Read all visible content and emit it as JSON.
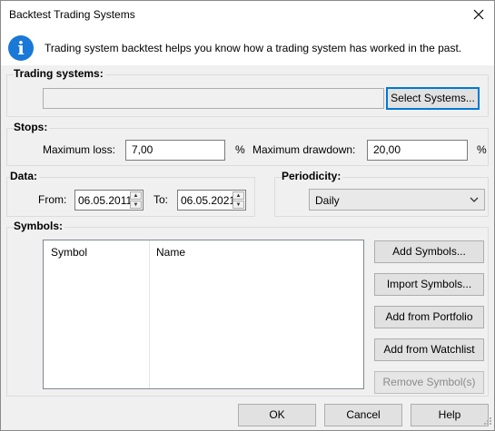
{
  "window": {
    "title": "Backtest Trading Systems",
    "close_icon": "close-icon"
  },
  "info": {
    "icon": "info-icon",
    "icon_glyph": "i",
    "text": "Trading system backtest helps you know how a trading system has worked in the past."
  },
  "trading_systems": {
    "label": "Trading systems:",
    "field_value": "",
    "select_button": "Select Systems..."
  },
  "stops": {
    "label": "Stops:",
    "max_loss_label": "Maximum loss:",
    "max_loss_value": "7,00",
    "max_loss_unit": "%",
    "max_drawdown_label": "Maximum drawdown:",
    "max_drawdown_value": "20,00",
    "max_drawdown_unit": "%"
  },
  "data": {
    "label": "Data:",
    "from_label": "From:",
    "from_value": "06.05.2011",
    "to_label": "To:",
    "to_value": "06.05.2021"
  },
  "periodicity": {
    "label": "Periodicity:",
    "selected": "Daily"
  },
  "symbols": {
    "label": "Symbols:",
    "columns": [
      "Symbol",
      "Name"
    ],
    "rows": [],
    "buttons": {
      "add": "Add Symbols...",
      "import": "Import Symbols...",
      "from_portfolio": "Add from Portfolio",
      "from_watchlist": "Add from Watchlist",
      "remove": "Remove Symbol(s)"
    }
  },
  "footer": {
    "ok": "OK",
    "cancel": "Cancel",
    "help": "Help"
  },
  "colors": {
    "accent": "#0078d7",
    "info_icon": "#1a78d6"
  }
}
